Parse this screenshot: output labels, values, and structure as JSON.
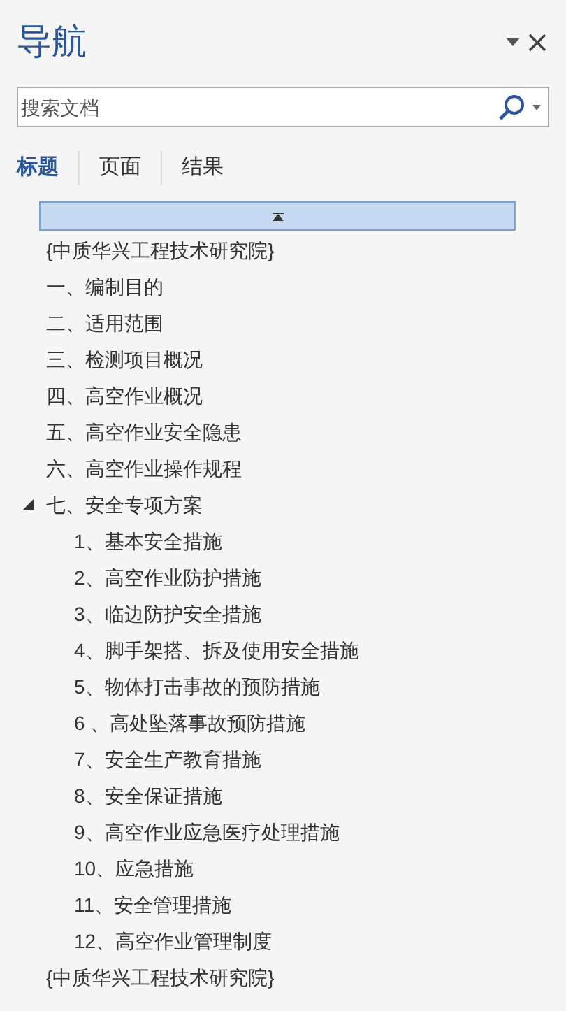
{
  "pane": {
    "title": "导航"
  },
  "search": {
    "placeholder": "搜索文档"
  },
  "tabs": [
    {
      "label": "标题",
      "selected": true
    },
    {
      "label": "页面",
      "selected": false
    },
    {
      "label": "结果",
      "selected": false
    }
  ],
  "tree": [
    {
      "label": "{中质华兴工程技术研究院}"
    },
    {
      "label": "一、编制目的"
    },
    {
      "label": "二、适用范围"
    },
    {
      "label": "三、检测项目概况"
    },
    {
      "label": "四、高空作业概况"
    },
    {
      "label": "五、高空作业安全隐患"
    },
    {
      "label": "六、高空作业操作规程"
    },
    {
      "label": "七、安全专项方案",
      "expanded": true,
      "children": [
        {
          "label": "1、基本安全措施"
        },
        {
          "label": "2、高空作业防护措施"
        },
        {
          "label": "3、临边防护安全措施"
        },
        {
          "label": "4、脚手架搭、拆及使用安全措施"
        },
        {
          "label": "5、物体打击事故的预防措施"
        },
        {
          "label": "6 、高处坠落事故预防措施"
        },
        {
          "label": "7、安全生产教育措施"
        },
        {
          "label": "8、安全保证措施"
        },
        {
          "label": "9、高空作业应急医疗处理措施"
        },
        {
          "label": "10、应急措施"
        },
        {
          "label": "11、安全管理措施"
        },
        {
          "label": "12、高空作业管理制度"
        }
      ]
    },
    {
      "label": "{中质华兴工程技术研究院}"
    }
  ]
}
